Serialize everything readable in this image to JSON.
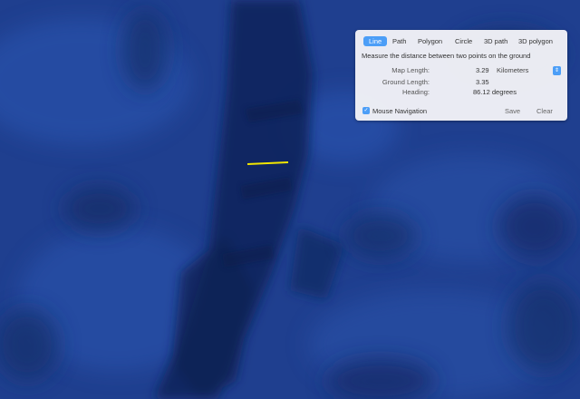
{
  "tabs": [
    {
      "label": "Line",
      "active": true
    },
    {
      "label": "Path",
      "active": false
    },
    {
      "label": "Polygon",
      "active": false
    },
    {
      "label": "Circle",
      "active": false
    },
    {
      "label": "3D path",
      "active": false
    },
    {
      "label": "3D polygon",
      "active": false
    }
  ],
  "hint": "Measure the distance between two points on the ground",
  "measurements": {
    "map_length_label": "Map Length:",
    "map_length_value": "3.29",
    "ground_length_label": "Ground Length:",
    "ground_length_value": "3.35",
    "heading_label": "Heading:",
    "heading_value": "86.12 degrees"
  },
  "units": {
    "selected": "Kilometers",
    "stepper_icon": "updown-chevron-icon"
  },
  "mouse_navigation": {
    "label": "Mouse Navigation",
    "checked": true
  },
  "buttons": {
    "save": "Save",
    "clear": "Clear"
  },
  "colors": {
    "ocean": "#1f3f8f",
    "accent": "#4c9ef7",
    "measure_line": "#f2e600"
  }
}
